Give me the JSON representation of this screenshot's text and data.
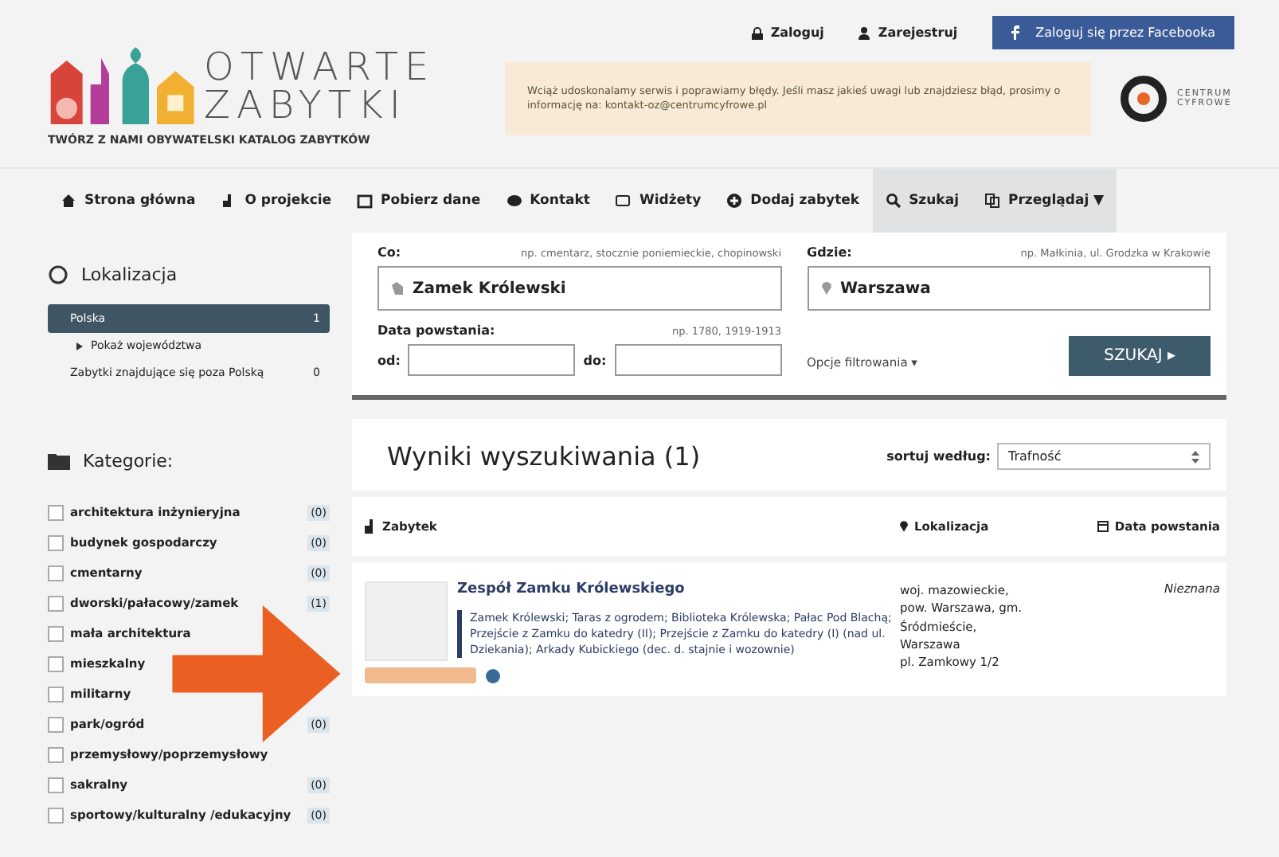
{
  "header": {
    "logo_line1": "OTWARTE",
    "logo_line2": "ZABYTKI",
    "tagline": "TWÓRZ Z NAMI OBYWATELSKI KATALOG ZABYTKÓW",
    "login": "Zaloguj",
    "register": "Zarejestruj",
    "facebook": "Zaloguj się przez Facebooka",
    "notice": "Wciąż udoskonalamy serwis i poprawiamy błędy. Jeśli masz jakieś uwagi lub znajdziesz błąd, prosimy o informację na: kontakt-oz@centrumcyfrowe.pl",
    "partner": "CENTRUM CYFROWE"
  },
  "nav": [
    {
      "label": "Strona główna",
      "selected": false
    },
    {
      "label": "O projekcie",
      "selected": false
    },
    {
      "label": "Pobierz dane",
      "selected": false
    },
    {
      "label": "Kontakt",
      "selected": false
    },
    {
      "label": "Widżety",
      "selected": false
    },
    {
      "label": "Dodaj zabytek",
      "selected": false
    },
    {
      "label": "Szukaj",
      "selected": true
    },
    {
      "label": "Przeglądaj ▼",
      "selected": true
    }
  ],
  "sidebar": {
    "location_title": "Lokalizacja",
    "locations": [
      {
        "label": "Polska",
        "count": "1",
        "selected": true,
        "children": [
          {
            "label": "Pokaż województwa"
          }
        ]
      },
      {
        "label": "Zabytki znajdujące się poza Polską",
        "count": "0",
        "selected": false
      }
    ],
    "categories_title": "Kategorie:",
    "categories": [
      {
        "label": "architektura inżynieryjna",
        "count": "(0)",
        "checked": false
      },
      {
        "label": "budynek gospodarczy",
        "count": "(0)",
        "checked": false
      },
      {
        "label": "cmentarny",
        "count": "(0)",
        "checked": false
      },
      {
        "label": "dworski/pałacowy/zamek",
        "count": "(1)",
        "checked": false
      },
      {
        "label": "mała architektura",
        "checked": false
      },
      {
        "label": "mieszkalny",
        "checked": false
      },
      {
        "label": "militarny",
        "checked": false
      },
      {
        "label": "park/ogród",
        "count": "(0)",
        "checked": false
      },
      {
        "label": "przemysłowy/poprzemysłowy",
        "checked": false
      },
      {
        "label": "sakralny",
        "count": "(0)",
        "checked": false
      },
      {
        "label": "sportowy/kulturalny /edukacyjny",
        "count": "(0)",
        "checked": false
      }
    ]
  },
  "search": {
    "what_label": "Co:",
    "what_hint": "np. cmentarz, stocznie poniemieckie, chopinowski",
    "what_value": "Zamek Królewski",
    "where_label": "Gdzie:",
    "where_hint": "np. Małkinia, ul. Grodzka w Krakowie",
    "where_value": "Warszawa",
    "date_label": "Data powstania:",
    "date_hint": "np. 1780, 1919-1913",
    "from_label": "od:",
    "to_label": "do:",
    "filter_link": "Opcje filtrowania ▾",
    "submit": "SZUKAJ ▸"
  },
  "results": {
    "title": "Wyniki wyszukiwania (1)",
    "sort_label": "sortuj według:",
    "sort_value": "Trafność",
    "columns": [
      "Zabytek",
      "Lokalizacja",
      "Data powstania"
    ],
    "rows": [
      {
        "name": "Zespół Zamku Królewskiego",
        "description": "Zamek Królewski; Taras z ogrodem; Biblioteka Królewska; Pałac Pod Blachą; Przejście z Zamku do katedry (II); Przejście z Zamku do katedry (I) (nad ul. Dziekania); Arkady Kubickiego (dec. d. stajnie i wozownie)",
        "location": [
          "woj. mazowieckie,",
          "pow. Warszawa, gm.",
          "Śródmieście,",
          "Warszawa",
          "pl. Zamkowy 1/2"
        ],
        "date": "Nieznana"
      }
    ]
  }
}
